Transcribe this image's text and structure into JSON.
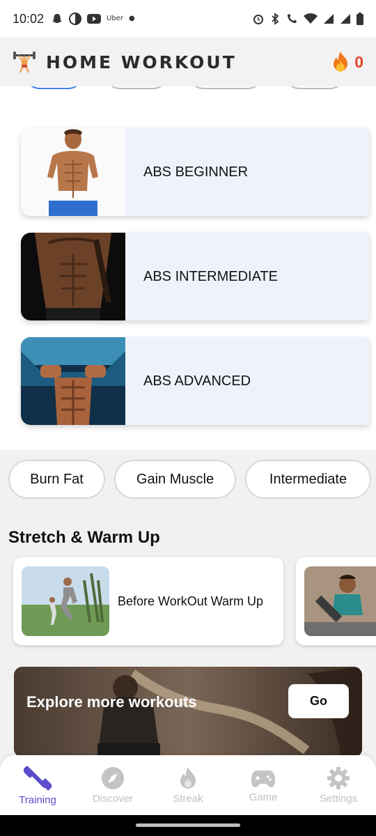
{
  "status_bar": {
    "time": "10:02",
    "left_icons": [
      "snapchat-icon",
      "maps-icon",
      "youtube-icon",
      "uber-icon",
      "dot-icon"
    ],
    "uber_text": "Uber",
    "right_icons": [
      "alarm-icon",
      "bluetooth-icon",
      "wifi-call-icon",
      "wifi-icon",
      "signal-icon",
      "signal-icon",
      "battery-icon"
    ]
  },
  "header": {
    "title": "HOME WORKOUT",
    "logo_icon": "weightlifter-icon",
    "streak_icon": "fire-icon",
    "streak_count": "0"
  },
  "plans": [
    {
      "label": "ABS BEGINNER"
    },
    {
      "label": "ABS INTERMEDIATE"
    },
    {
      "label": "ABS ADVANCED"
    }
  ],
  "chips": [
    "Burn Fat",
    "Gain Muscle",
    "Intermediate"
  ],
  "warm_up": {
    "section_title": "Stretch & Warm Up",
    "cards": [
      {
        "label": "Before WorkOut Warm Up"
      },
      {
        "label": ""
      }
    ]
  },
  "explore": {
    "text": "Explore more workouts",
    "button": "Go"
  },
  "bottom_nav": [
    {
      "label": "Training",
      "icon": "dumbbell-icon",
      "active": true
    },
    {
      "label": "Discover",
      "icon": "compass-icon",
      "active": false
    },
    {
      "label": "Streak",
      "icon": "flame-icon",
      "active": false
    },
    {
      "label": "Game",
      "icon": "gamepad-icon",
      "active": false
    },
    {
      "label": "Settings",
      "icon": "gear-icon",
      "active": false
    }
  ],
  "colors": {
    "accent": "#5b4ccc",
    "streak": "#e2472b",
    "card_bg": "#eef3fb"
  }
}
